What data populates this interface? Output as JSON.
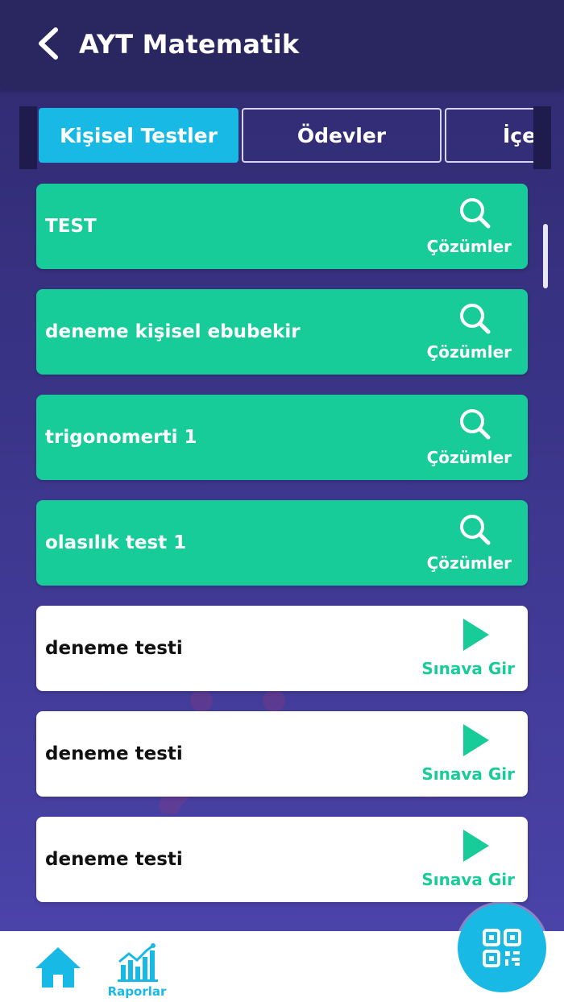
{
  "header": {
    "title": "AYT Matematik"
  },
  "tabs": [
    {
      "label": "Kişisel Testler",
      "active": true
    },
    {
      "label": "Ödevler",
      "active": false
    },
    {
      "label": "İçe",
      "active": false
    }
  ],
  "tests": [
    {
      "name": "TEST",
      "status": "completed",
      "action_label": "Çözümler",
      "icon": "search-icon"
    },
    {
      "name": "deneme kişisel ebubekir",
      "status": "completed",
      "action_label": "Çözümler",
      "icon": "search-icon"
    },
    {
      "name": "trigonomerti 1",
      "status": "completed",
      "action_label": "Çözümler",
      "icon": "search-icon"
    },
    {
      "name": "olasılık test 1",
      "status": "completed",
      "action_label": "Çözümler",
      "icon": "search-icon"
    },
    {
      "name": "deneme testi",
      "status": "pending",
      "action_label": "Sınava Gir",
      "icon": "play-icon"
    },
    {
      "name": "deneme testi",
      "status": "pending",
      "action_label": "Sınava Gir",
      "icon": "play-icon"
    },
    {
      "name": "deneme testi",
      "status": "pending",
      "action_label": "Sınava Gir",
      "icon": "play-icon"
    }
  ],
  "bottom_nav": {
    "reports_label": "Raporlar"
  },
  "colors": {
    "header_bg": "#2a2660",
    "accent": "#19b9e6",
    "completed": "#17cc98",
    "pending_bg": "#ffffff"
  }
}
